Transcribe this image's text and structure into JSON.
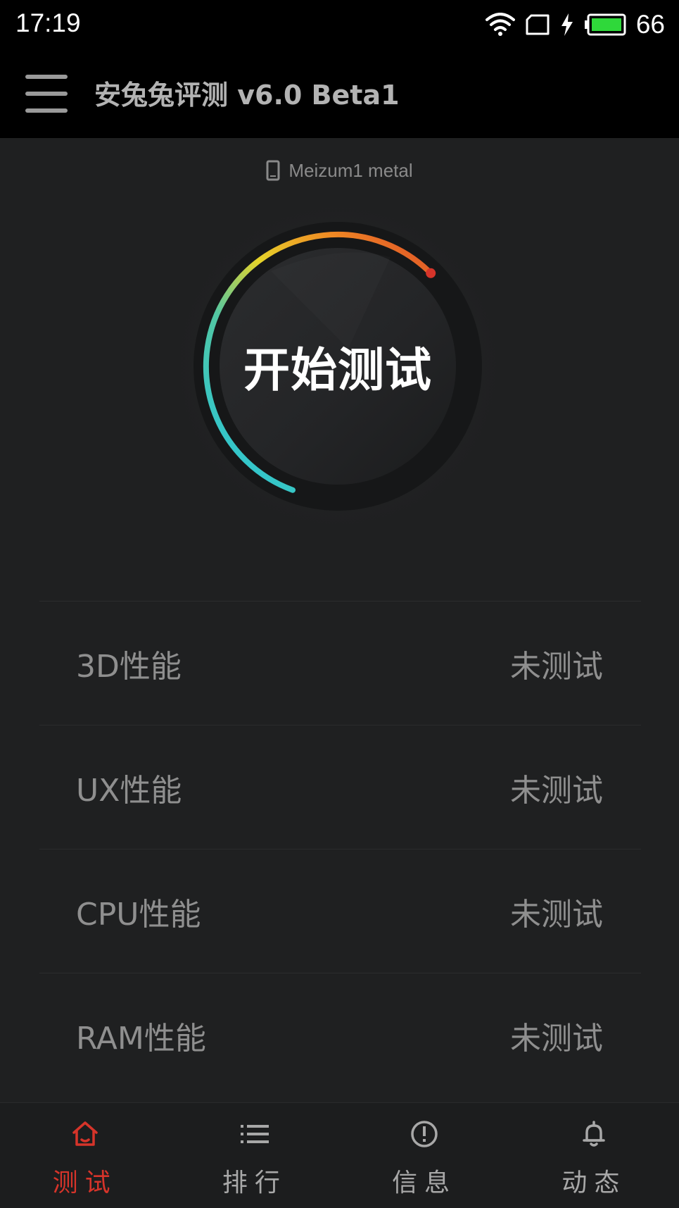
{
  "status_bar": {
    "time": "17:19",
    "battery_level": "66",
    "wifi_icon": "wifi-icon",
    "charging_icon": "bolt-icon"
  },
  "app_bar": {
    "title": "安兔兔评测 v6.0 Beta1",
    "menu_icon": "hamburger-menu-icon"
  },
  "device": {
    "name": "Meizum1 metal",
    "icon": "phone-icon"
  },
  "gauge": {
    "label": "开始测试",
    "colors": [
      "#2bc6d6",
      "#e6d42a",
      "#f08a24",
      "#d6342a"
    ]
  },
  "results": [
    {
      "name": "3D性能",
      "status": "未测试"
    },
    {
      "name": "UX性能",
      "status": "未测试"
    },
    {
      "name": "CPU性能",
      "status": "未测试"
    },
    {
      "name": "RAM性能",
      "status": "未测试"
    }
  ],
  "nav": [
    {
      "label": "测试",
      "icon": "home-icon",
      "active": true
    },
    {
      "label": "排行",
      "icon": "list-icon",
      "active": false
    },
    {
      "label": "信息",
      "icon": "info-icon",
      "active": false
    },
    {
      "label": "动态",
      "icon": "bell-icon",
      "active": false
    }
  ],
  "colors": {
    "accent": "#d6342a",
    "background": "#1f2021",
    "bar": "#000000"
  }
}
